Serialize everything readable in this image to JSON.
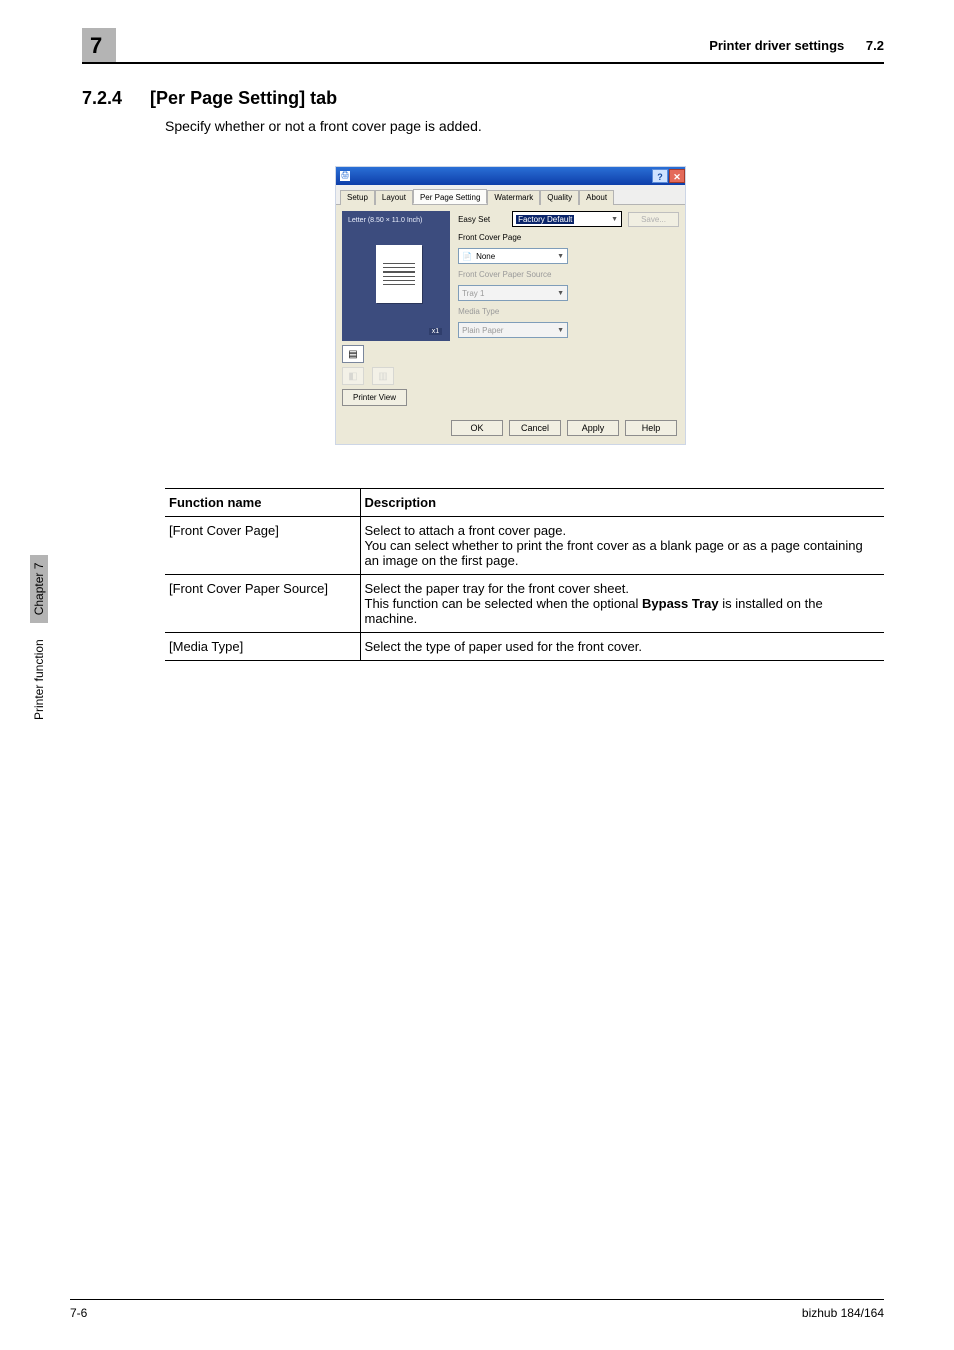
{
  "header": {
    "chapter_digit": "7",
    "breadcrumb": "Printer driver settings",
    "section_ref": "7.2"
  },
  "section": {
    "number": "7.2.4",
    "title": "[Per Page Setting] tab",
    "intro": "Specify whether or not a front cover page is added."
  },
  "dialog": {
    "tabs": [
      "Setup",
      "Layout",
      "Per Page Setting",
      "Watermark",
      "Quality",
      "About"
    ],
    "active_tab": "Per Page Setting",
    "preview_paper_label": "Letter (8.50 × 11.0 Inch)",
    "x1": "x1",
    "printer_view_btn": "Printer View",
    "easy_set_label": "Easy Set",
    "easy_set_value": "Factory Default",
    "save_btn": "Save...",
    "front_cover_page_label": "Front Cover Page",
    "front_cover_page_value": "None",
    "front_cover_source_label": "Front Cover Paper Source",
    "front_cover_source_value": "Tray 1",
    "media_type_label": "Media Type",
    "media_type_value": "Plain Paper",
    "buttons": {
      "ok": "OK",
      "cancel": "Cancel",
      "apply": "Apply",
      "help": "Help"
    }
  },
  "table": {
    "headers": [
      "Function name",
      "Description"
    ],
    "rows": [
      {
        "name": "[Front Cover Page]",
        "desc_plain": "Select to attach a front cover page.\nYou can select whether to print the front cover as a blank page or as a page containing an image on the first page."
      },
      {
        "name": "[Front Cover Paper Source]",
        "desc_pre": "Select the paper tray for the front cover sheet.\nThis function can be selected when the optional ",
        "desc_bold": "Bypass Tray",
        "desc_post": " is installed on the machine."
      },
      {
        "name": "[Media Type]",
        "desc_plain": "Select the type of paper used for the front cover."
      }
    ]
  },
  "side": {
    "func": "Printer function",
    "chap": "Chapter 7"
  },
  "footer": {
    "page": "7-6",
    "model": "bizhub 184/164"
  }
}
